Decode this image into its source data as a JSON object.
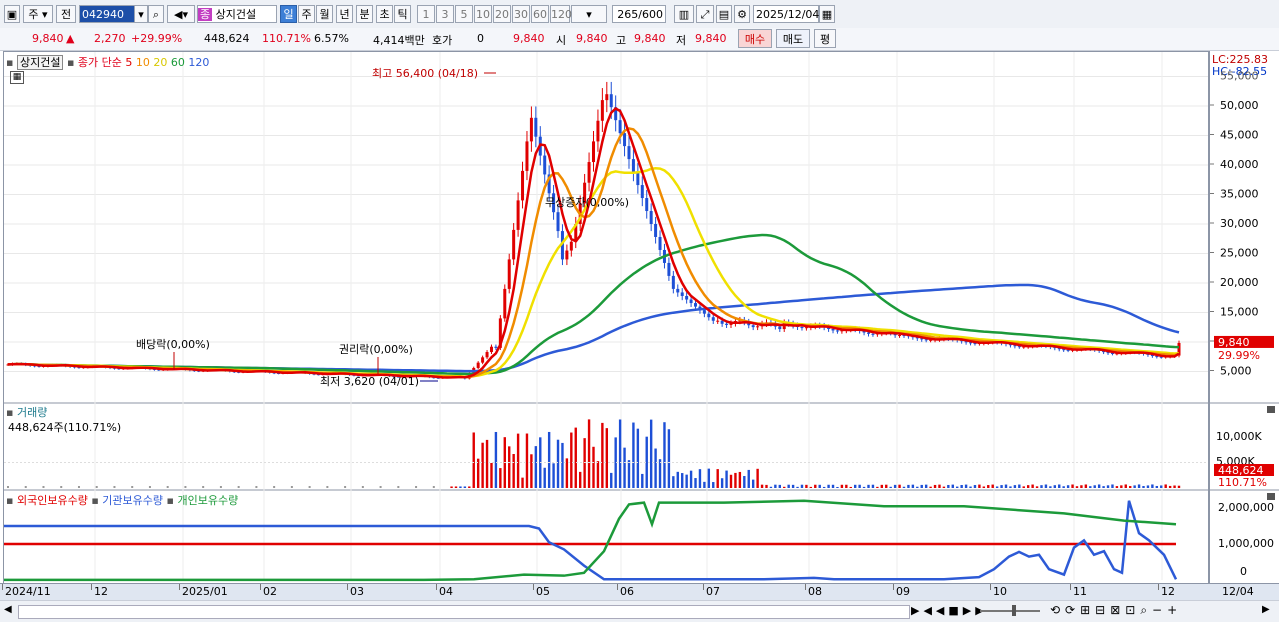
{
  "toolbar": {
    "tab_ju": "주",
    "tab_jeon": "전",
    "code": "042940",
    "name_badge": "종",
    "stock_name": "상지건설",
    "periods": [
      "일",
      "주",
      "월",
      "년",
      "분",
      "초",
      "틱"
    ],
    "numbers": [
      "1",
      "3",
      "5",
      "10",
      "20",
      "30",
      "60",
      "120"
    ],
    "count": "265",
    "count_total": "/600",
    "date": "2025/12/04"
  },
  "quote": {
    "price": "9,840",
    "change": "2,270",
    "change_pct": "+29.99%",
    "volume": "448,624",
    "vol_ratio": "110.71%",
    "turnover": "6.57%",
    "amount": "4,414백만",
    "hoga_label": "호가",
    "hoga_value": "0",
    "hoga_price": "9,840",
    "open_label": "시",
    "open": "9,840",
    "high_label": "고",
    "high": "9,840",
    "low_label": "저",
    "low": "9,840",
    "buy": "매수",
    "sell": "매도",
    "flat": "평"
  },
  "price_panel": {
    "name_tag": "상지건설",
    "ma_label": "종가 단순",
    "ma_periods": [
      "5",
      "10",
      "20",
      "60",
      "120"
    ],
    "high_note": "최고 56,400 (04/18)",
    "low_note": "최저 3,620 (04/01)",
    "div_note": "배당락(0,00%)",
    "right_note": "권리락(0,00%)",
    "bonus_note": "무상증자(0,00%)",
    "lc": "LC:225.83",
    "hc": "HC:-82.55",
    "last_price": "9,840",
    "last_pct": "29.99%",
    "y_ticks": [
      "55,000",
      "50,000",
      "45,000",
      "40,000",
      "35,000",
      "30,000",
      "25,000",
      "20,000",
      "15,000",
      "10,000",
      "5,000"
    ]
  },
  "volume_panel": {
    "title": "거래량",
    "value": "448,624주(110.71%)",
    "ticks": [
      "10,000K",
      "5,000K"
    ],
    "last": "448,624",
    "last_pct": "110.71%"
  },
  "holding_panel": {
    "s1": "외국인보유수량",
    "s2": "기관보유수량",
    "s3": "개인보유수량",
    "ticks": [
      "2,000,000",
      "1,000,000",
      "0"
    ]
  },
  "xaxis": [
    "2024/11",
    "12",
    "2025/01",
    "02",
    "03",
    "04",
    "05",
    "06",
    "07",
    "08",
    "09",
    "10",
    "11",
    "12"
  ],
  "xaxis_last": "12/04",
  "colors": {
    "ma5": "#e00000",
    "ma10": "#f08c00",
    "ma20": "#f0e000",
    "ma60": "#1c9a3a",
    "ma120": "#2d5ad6",
    "up": "#e00000",
    "down": "#1d4fd6"
  }
}
